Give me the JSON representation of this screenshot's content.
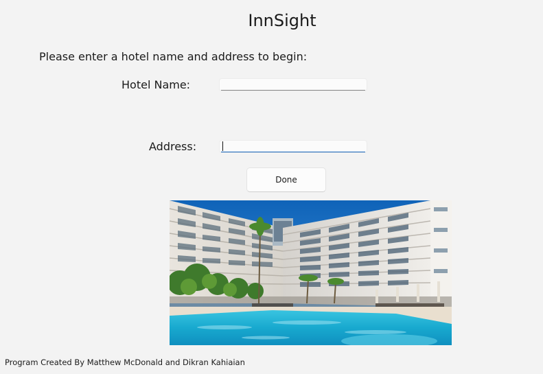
{
  "app": {
    "title": "InnSight"
  },
  "form": {
    "instruction": "Please enter a hotel name and address to begin:",
    "hotel_name_label": "Hotel Name:",
    "hotel_name_value": "",
    "address_label": "Address:",
    "address_value": "",
    "done_label": "Done"
  },
  "image": {
    "subject": "hotel-with-pool-photo"
  },
  "footer": {
    "credit": "Program Created By Matthew McDonald and Dikran Kahiaian"
  },
  "colors": {
    "background": "#f3f3f3",
    "focus_accent": "#0f5fb8",
    "sky": "#1d73c4",
    "pool": "#2bb6d6"
  }
}
